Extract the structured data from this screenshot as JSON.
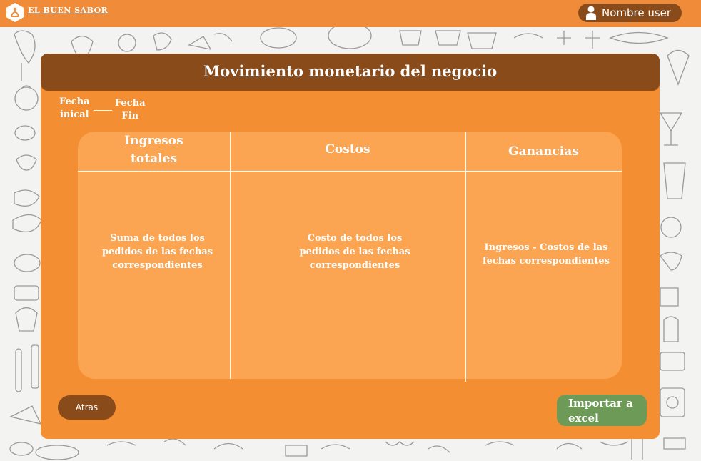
{
  "header": {
    "brand": "EL BUEN SABOR",
    "user_name": "Nombre user"
  },
  "panel": {
    "title": "Movimiento monetario del negocio",
    "date_start_line1": "Fecha",
    "date_start_line2": "inical",
    "date_end_line1": "Fecha",
    "date_end_line2": "Fin"
  },
  "table": {
    "columns": [
      {
        "header_line1": "Ingresos",
        "header_line2": "totales",
        "body_line1": "Suma de todos los",
        "body_line2": "pedidos de las fechas",
        "body_line3": "correspondientes"
      },
      {
        "header_line1": "Costos",
        "body_line1": "Costo de todos los",
        "body_line2": "pedidos de las fechas",
        "body_line3": "correspondientes"
      },
      {
        "header_line1": "Ganancias",
        "body_line1": "Ingresos - Costos de las",
        "body_line2": "fechas correspondientes"
      }
    ]
  },
  "buttons": {
    "back": "Atras",
    "export_line1": "Importar a",
    "export_line2": "excel"
  },
  "colors": {
    "topbar": "#ef8b39",
    "panel": "#f48e33",
    "header_brown": "#8a4b1a",
    "table": "#fba553",
    "excel_green": "#6d9a57"
  },
  "icons": {
    "logo": "chef-hat-logo-icon",
    "user": "person-icon"
  }
}
